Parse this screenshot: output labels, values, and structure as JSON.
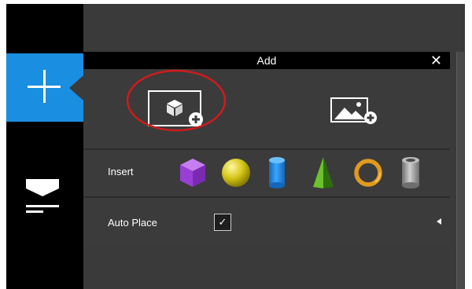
{
  "panel": {
    "title": "Add",
    "close_glyph": "✕"
  },
  "insert_row": {
    "label": "Insert",
    "shapes": [
      {
        "name": "cube",
        "color": "#9a3fd6"
      },
      {
        "name": "sphere",
        "color": "#d6c81a"
      },
      {
        "name": "cylinder",
        "color": "#1f7fd9"
      },
      {
        "name": "cone",
        "color": "#4b9e1e"
      },
      {
        "name": "torus",
        "color": "#e09a1e"
      },
      {
        "name": "pipe",
        "color": "#9a9a9a"
      }
    ]
  },
  "auto_place_row": {
    "label": "Auto Place",
    "checked_glyph": "✓"
  },
  "colors": {
    "accent": "#1a8ee0",
    "highlight_ring": "#d01b1b",
    "panel_bg": "#3b3b3b",
    "header_bg": "#000000"
  },
  "icons": {
    "add_tab": "plus-icon",
    "place_tab": "place-on-surface-icon",
    "add_object": "cube-plus-icon",
    "add_image": "image-plus-icon",
    "expand": "triangle-left-icon"
  }
}
